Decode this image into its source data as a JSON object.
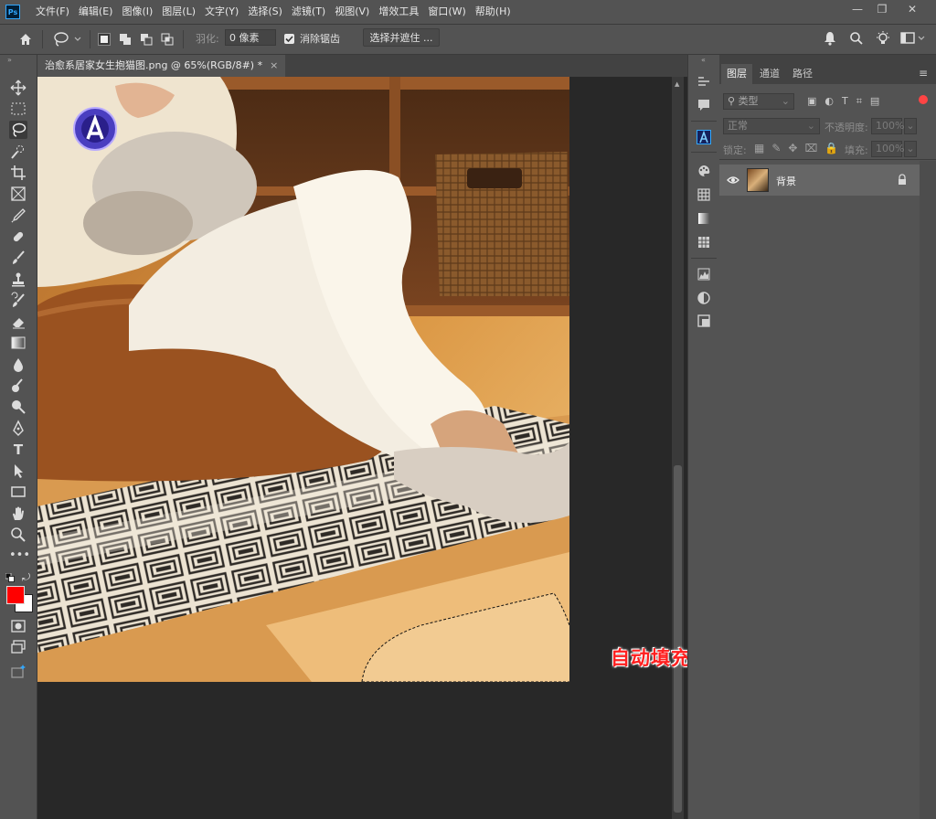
{
  "app": {
    "logo": "Ps"
  },
  "menu": [
    "文件(F)",
    "编辑(E)",
    "图像(I)",
    "图层(L)",
    "文字(Y)",
    "选择(S)",
    "滤镜(T)",
    "视图(V)",
    "增效工具",
    "窗口(W)",
    "帮助(H)"
  ],
  "options": {
    "feather_label": "羽化:",
    "feather_value": "0 像素",
    "antialias_label": "消除锯齿",
    "select_mask_button": "选择并遮住 ..."
  },
  "document": {
    "tab_title": "治愈系居家女生抱猫图.png @ 65%(RGB/8#) *",
    "close_symbol": "×"
  },
  "caption": "自动填充的效果展示",
  "panel": {
    "tabs": [
      "图层",
      "通道",
      "路径"
    ],
    "filter_placeholder": "类型",
    "blend_mode": "正常",
    "opacity_label": "不透明度:",
    "opacity_value": "100%",
    "lock_label": "锁定:",
    "fill_label": "填充:",
    "fill_value": "100%",
    "layers": [
      {
        "name": "背景",
        "visible": true,
        "locked": true
      }
    ]
  },
  "colors": {
    "foreground": "#ff0000",
    "background": "#ffffff",
    "accent": "#31a8ff",
    "caption": "#ff1f1f"
  }
}
